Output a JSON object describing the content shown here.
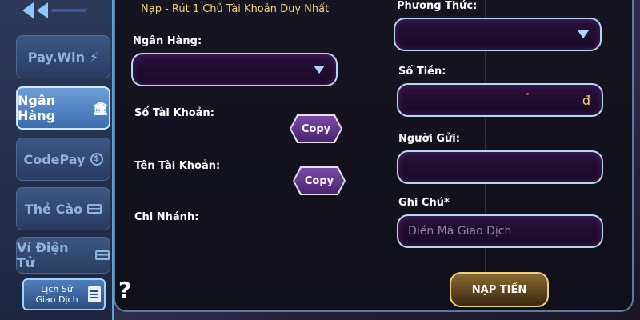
{
  "panel": {
    "title": "Nạp - Rút 1 Chủ Tài Khoản Duy Nhất"
  },
  "sidebar": {
    "items": [
      {
        "label": "Pay.Win",
        "icon": "lightning-icon"
      },
      {
        "label": "Ngân Hàng",
        "icon": "bank-icon",
        "active": true
      },
      {
        "label": "CodePay",
        "icon": "coin-icon"
      },
      {
        "label": "Thẻ Cào",
        "icon": "card-icon"
      },
      {
        "label": "Ví Điện Tử",
        "icon": "wallet-icon"
      }
    ],
    "history_line1": "Lịch Sử",
    "history_line2": "Giao Dịch"
  },
  "left": {
    "bank_label": "Ngân Hàng:",
    "account_number_label": "Số Tài Khoản:",
    "account_name_label": "Tên Tài Khoản:",
    "branch_label": "Chi Nhánh:",
    "copy_label": "Copy"
  },
  "right": {
    "method_label": "Phương Thức:",
    "amount_label": "Số Tiền:",
    "currency": "đ",
    "sender_label": "Người Gửi:",
    "note_label": "Ghi Chú*",
    "note_placeholder": "Điền Mã Giao Dịch",
    "submit_label": "NẠP TIỀN"
  },
  "help": "?",
  "colors": {
    "title": "#f3d37a",
    "field_border": "#b7d6ef",
    "accent": "#5ea0d0"
  }
}
